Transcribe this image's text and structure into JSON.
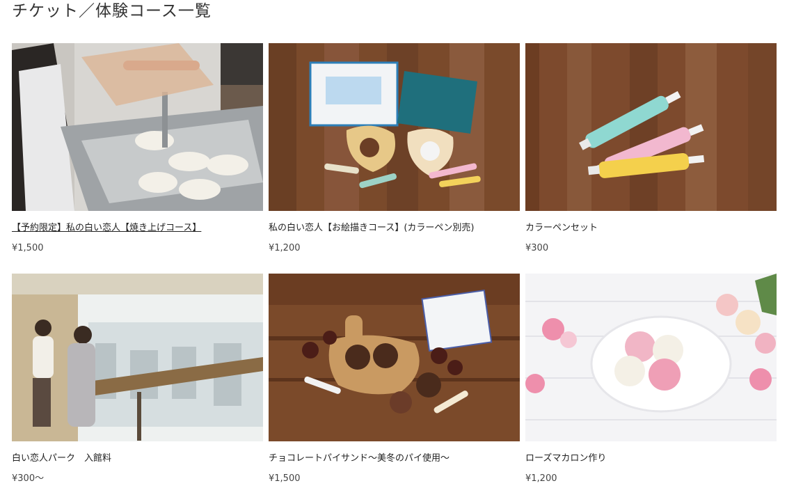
{
  "page": {
    "title": "チケット／体験コース一覧"
  },
  "products": [
    {
      "title": "【予約限定】私の白い恋人【焼き上げコース】",
      "price": "¥1,500",
      "image": "baking-press-photo"
    },
    {
      "title": "私の白い恋人【お絵描きコース】(カラーペン別売)",
      "price": "¥1,200",
      "image": "decorated-cookies-photo"
    },
    {
      "title": "カラーペンセット",
      "price": "¥300",
      "image": "color-pens-photo"
    },
    {
      "title": "白い恋人パーク　入館料",
      "price": "¥300〜",
      "image": "factory-tour-photo"
    },
    {
      "title": "チョコレートパイサンド〜美冬のパイ使用〜",
      "price": "¥1,500",
      "image": "chocolate-pie-photo"
    },
    {
      "title": "ローズマカロン作り",
      "price": "¥1,200",
      "image": "rose-macaron-photo"
    }
  ],
  "colors": {
    "title": "#333333",
    "text": "#222222",
    "price": "#444444",
    "wood": "#7a4a2b"
  }
}
